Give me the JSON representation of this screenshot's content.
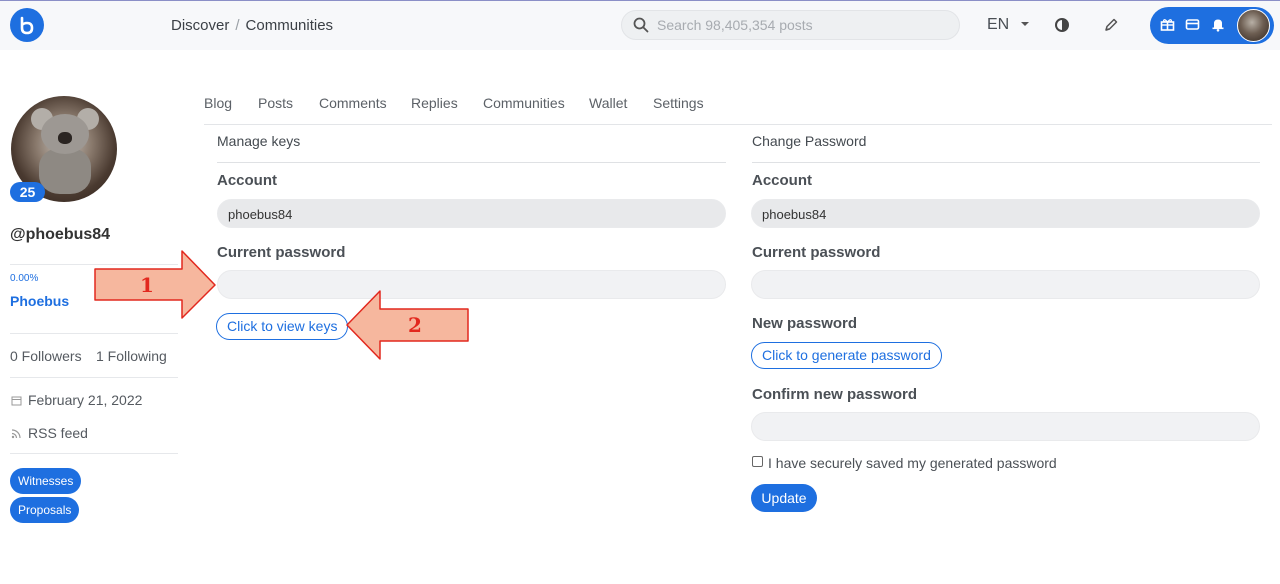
{
  "header": {
    "breadcrumb": [
      "Discover",
      "Communities"
    ],
    "breadcrumb_separator": "/",
    "search_placeholder": "Search 98,405,354 posts",
    "language": "EN"
  },
  "profile": {
    "reputation": "25",
    "username": "@phoebus84",
    "voting_power": "0.00%",
    "display_name": "Phoebus",
    "followers": "0 Followers",
    "following": "1 Following",
    "joined": "February 21, 2022",
    "rss": "RSS feed",
    "chips": [
      "Witnesses",
      "Proposals"
    ]
  },
  "tabs": [
    "Blog",
    "Posts",
    "Comments",
    "Replies",
    "Communities",
    "Wallet",
    "Settings"
  ],
  "manage_keys": {
    "title": "Manage keys",
    "account_label": "Account",
    "account_value": "phoebus84",
    "password_label": "Current password",
    "password_value": "",
    "view_keys_button": "Click to view keys"
  },
  "change_password": {
    "title": "Change Password",
    "account_label": "Account",
    "account_value": "phoebus84",
    "current_password_label": "Current password",
    "current_password_value": "",
    "new_password_label": "New password",
    "generate_button": "Click to generate password",
    "confirm_label": "Confirm new password",
    "confirm_value": "",
    "saved_checkbox_label": "I have securely saved my generated password",
    "saved_checked": false,
    "update_button": "Update"
  },
  "annotations": [
    "1",
    "2"
  ],
  "colors": {
    "accent": "#1e6fe0",
    "annotation_fill": "#f6b79e",
    "annotation_stroke": "#e2281e"
  }
}
